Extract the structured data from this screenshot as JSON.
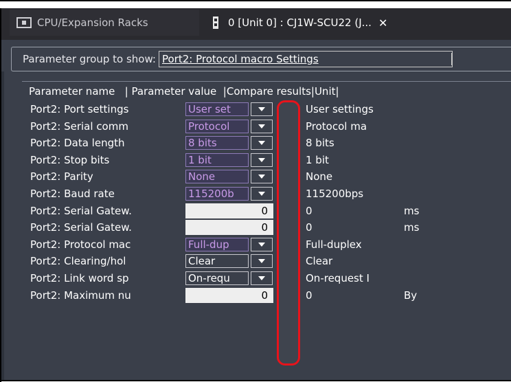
{
  "tabs": [
    {
      "label": "CPU/Expansion Racks",
      "icon": "monitor-icon",
      "active": false
    },
    {
      "label": "0 [Unit 0] : CJ1W-SCU22 (J...",
      "icon": "unit-module-icon",
      "active": true,
      "close": "✕"
    }
  ],
  "group": {
    "label": "Parameter group to show:",
    "selected": "Port2: Protocol macro Settings"
  },
  "table": {
    "headers": "Parameter name   | Parameter value  |Compare results|Unit|",
    "rows": [
      {
        "name": "Port2: Port settings",
        "kind": "select",
        "style": "purple",
        "value": "User set",
        "compare": "User settings",
        "unit": ""
      },
      {
        "name": "Port2: Serial comm",
        "kind": "select",
        "style": "purple",
        "value": "Protocol",
        "compare": "Protocol ma",
        "unit": ""
      },
      {
        "name": "Port2: Data length",
        "kind": "select",
        "style": "purple",
        "value": "8 bits",
        "compare": "8 bits",
        "unit": ""
      },
      {
        "name": "Port2: Stop bits",
        "kind": "select",
        "style": "purple",
        "value": "1 bit",
        "compare": "1 bit",
        "unit": ""
      },
      {
        "name": "Port2: Parity",
        "kind": "select",
        "style": "purple",
        "value": "None",
        "compare": "None",
        "unit": ""
      },
      {
        "name": "Port2: Baud rate",
        "kind": "select",
        "style": "purple",
        "value": "115200b",
        "compare": "115200bps",
        "unit": ""
      },
      {
        "name": "Port2: Serial Gatew.",
        "kind": "number",
        "value": "0",
        "compare": "0",
        "unit": "ms"
      },
      {
        "name": "Port2: Serial Gatew.",
        "kind": "number",
        "value": "0",
        "compare": "0",
        "unit": "ms"
      },
      {
        "name": "Port2: Protocol mac",
        "kind": "select",
        "style": "purple",
        "value": "Full-dup",
        "compare": "Full-duplex",
        "unit": ""
      },
      {
        "name": "Port2: Clearing/hol",
        "kind": "select",
        "style": "white",
        "value": "Clear",
        "compare": "Clear",
        "unit": ""
      },
      {
        "name": "Port2: Link word sp",
        "kind": "select",
        "style": "white",
        "value": "On-requ",
        "compare": "On-request I",
        "unit": ""
      },
      {
        "name": "Port2: Maximum nu",
        "kind": "number",
        "value": "0",
        "compare": "0",
        "unit": "By"
      }
    ]
  },
  "colors": {
    "panel_bg": "#3a3f4a",
    "modified_value": "#c89ae8",
    "highlight": "#e8131b"
  }
}
